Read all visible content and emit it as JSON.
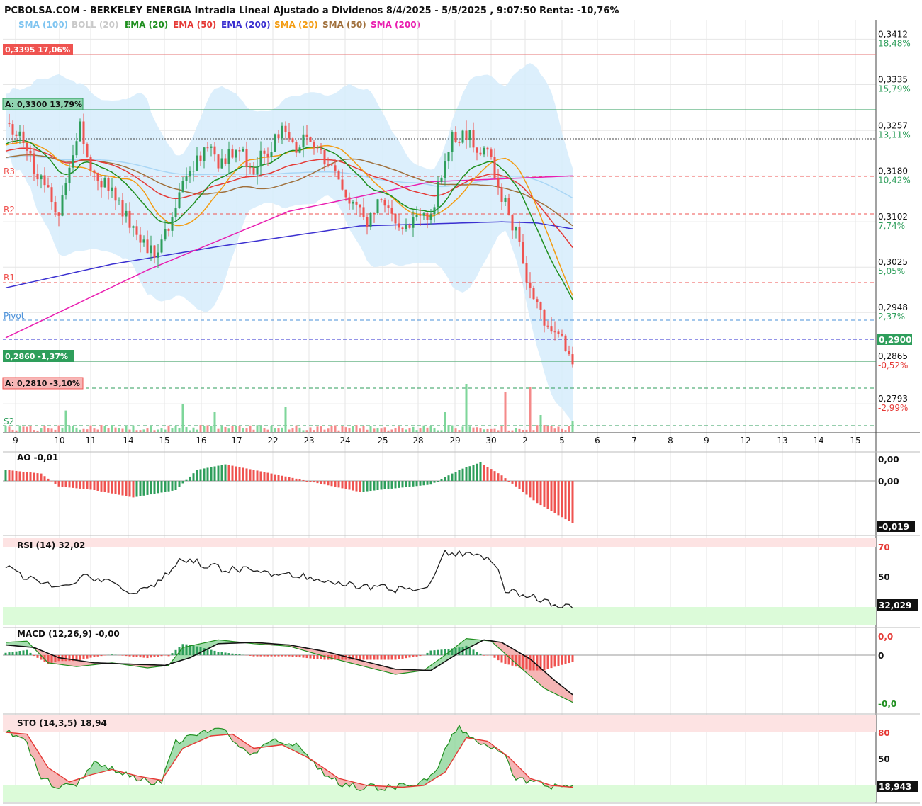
{
  "header": {
    "title": "PCBOLSA.COM - BERKELEY ENERGIA Intradia Lineal Ajustado a Dividenos 8/4/2025 - 5/5/2025 , 9:07:50 Renta: -10,76%",
    "legend": [
      {
        "label": "SMA (100)",
        "color": "#7ec4f0"
      },
      {
        "label": "BOLL (20)",
        "color": "#c9c9c9"
      },
      {
        "label": "EMA (20)",
        "color": "#1f8f1f"
      },
      {
        "label": "EMA (50)",
        "color": "#e53935"
      },
      {
        "label": "EMA (200)",
        "color": "#3a2fd0"
      },
      {
        "label": "SMA (20)",
        "color": "#f39c12"
      },
      {
        "label": "SMA (50)",
        "color": "#a0703c"
      },
      {
        "label": "SMA (200)",
        "color": "#e91eb0"
      }
    ]
  },
  "price_axis": {
    "ticks": [
      {
        "price": "0,3412",
        "pct": "18,48%",
        "pct_color": "#2e9e5b"
      },
      {
        "price": "0,3335",
        "pct": "15,79%",
        "pct_color": "#2e9e5b"
      },
      {
        "price": "0,3257",
        "pct": "13,11%",
        "pct_color": "#2e9e5b"
      },
      {
        "price": "0,3180",
        "pct": "10,42%",
        "pct_color": "#2e9e5b"
      },
      {
        "price": "0,3102",
        "pct": "7,74%",
        "pct_color": "#2e9e5b"
      },
      {
        "price": "0,3025",
        "pct": "5,05%",
        "pct_color": "#2e9e5b"
      },
      {
        "price": "0,2948",
        "pct": "2,37%",
        "pct_color": "#2e9e5b"
      },
      {
        "price": "0,2865",
        "pct": "-0,52%",
        "pct_color": "#e53935"
      },
      {
        "price": "0,2793",
        "pct": "-2,99%",
        "pct_color": "#e53935"
      }
    ],
    "last_price": "0,2900"
  },
  "levels": {
    "high_box": "0,3395  17,06%",
    "max_box": "A: 0,3300  13,79%",
    "close_box": "0,2860  -1,37%",
    "min_box": "A: 0,2810  -3,10%",
    "r3": "R3",
    "r2": "R2",
    "r1": "R1",
    "pivot": "Pivot",
    "s2": "S2"
  },
  "x_axis": {
    "labels": [
      "9",
      "10",
      "11",
      "14",
      "15",
      "16",
      "17",
      "22",
      "23",
      "24",
      "25",
      "28",
      "29",
      "30",
      "2",
      "5",
      "6",
      "7",
      "8",
      "9",
      "12",
      "13",
      "14",
      "15"
    ]
  },
  "panels": {
    "ao": {
      "name": "AO",
      "value": "-0,01",
      "tick_top": "0,00",
      "tick_mid": "0,00",
      "last": "-0,019"
    },
    "rsi": {
      "name": "RSI (14)",
      "value": "32,02",
      "tick_70": "70",
      "tick_50": "50",
      "last": "32,029"
    },
    "macd": {
      "name": "MACD (12,26,9)",
      "value": "-0,00",
      "tick_top": "0,0",
      "tick_mid": "0",
      "tick_bot": "-0,0"
    },
    "sto": {
      "name": "STO (14,3,5)",
      "value": "18,94",
      "tick_80": "80",
      "tick_50": "50",
      "last": "18,943"
    }
  },
  "colors": {
    "up": "#2e9e5b",
    "down": "#ef5350",
    "grid": "#e6e6e6"
  },
  "chart_data": {
    "type": "candlestick",
    "period": "8/4/2025 - 5/5/2025",
    "ylim": [
      0.2745,
      0.3445
    ],
    "return_pct": "-10,76%",
    "close_path": [
      [
        0,
        0.326
      ],
      [
        3,
        0.325
      ],
      [
        6,
        0.323
      ],
      [
        9,
        0.318
      ],
      [
        12,
        0.315
      ],
      [
        15,
        0.312
      ],
      [
        18,
        0.32
      ],
      [
        21,
        0.327
      ],
      [
        24,
        0.32
      ],
      [
        27,
        0.317
      ],
      [
        30,
        0.315
      ],
      [
        33,
        0.312
      ],
      [
        36,
        0.31
      ],
      [
        39,
        0.306
      ],
      [
        42,
        0.305
      ],
      [
        45,
        0.308
      ],
      [
        48,
        0.314
      ],
      [
        51,
        0.318
      ],
      [
        54,
        0.321
      ],
      [
        57,
        0.323
      ],
      [
        60,
        0.32
      ],
      [
        63,
        0.322
      ],
      [
        66,
        0.323
      ],
      [
        69,
        0.318
      ],
      [
        72,
        0.321
      ],
      [
        75,
        0.323
      ],
      [
        78,
        0.325
      ],
      [
        81,
        0.323
      ],
      [
        84,
        0.324
      ],
      [
        87,
        0.323
      ],
      [
        90,
        0.32
      ],
      [
        93,
        0.318
      ],
      [
        96,
        0.315
      ],
      [
        99,
        0.312
      ],
      [
        102,
        0.31
      ],
      [
        105,
        0.313
      ],
      [
        108,
        0.312
      ],
      [
        111,
        0.31
      ],
      [
        114,
        0.31
      ],
      [
        117,
        0.311
      ],
      [
        120,
        0.3105
      ],
      [
        123,
        0.319
      ],
      [
        126,
        0.324
      ],
      [
        129,
        0.325
      ],
      [
        132,
        0.324
      ],
      [
        135,
        0.322
      ],
      [
        138,
        0.319
      ],
      [
        141,
        0.313
      ],
      [
        144,
        0.308
      ],
      [
        147,
        0.3
      ],
      [
        150,
        0.296
      ],
      [
        153,
        0.293
      ],
      [
        156,
        0.291
      ],
      [
        159,
        0.2885
      ],
      [
        160,
        0.286
      ]
    ],
    "indicators": {
      "ema20_last": 0.298,
      "sma20_last": 0.301,
      "ema50_last": 0.3085,
      "sma50_last": 0.3095,
      "ema200_last": 0.3095,
      "sma200_last": 0.318,
      "sma100_last": 0.315
    },
    "volume": [
      {
        "x": 17,
        "v": 0.38,
        "up": true
      },
      {
        "x": 50,
        "v": 0.5,
        "up": true
      },
      {
        "x": 59,
        "v": 0.35,
        "up": true
      },
      {
        "x": 79,
        "v": 0.45,
        "up": true
      },
      {
        "x": 124,
        "v": 0.35,
        "up": true
      },
      {
        "x": 130,
        "v": 0.85,
        "up": true
      },
      {
        "x": 141,
        "v": 0.7,
        "up": false
      },
      {
        "x": 148,
        "v": 0.8,
        "up": false
      },
      {
        "x": 151,
        "v": 0.3,
        "up": true
      },
      {
        "x": 160,
        "v": 0.2,
        "up": true
      }
    ]
  }
}
